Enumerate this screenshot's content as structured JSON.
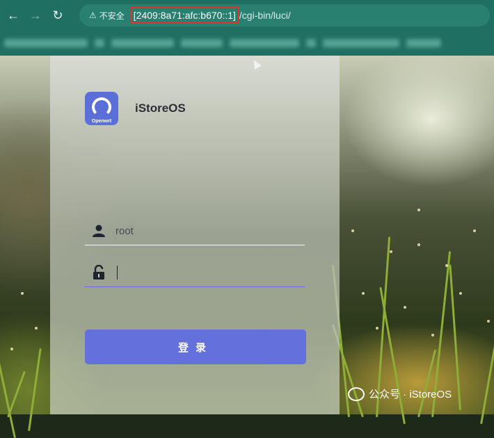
{
  "browser": {
    "security_label": "不安全",
    "url_host": "[2409:8a71:afc:b670::1]",
    "url_path": "/cgi-bin/luci/",
    "back_icon": "arrow-left-icon",
    "forward_icon": "arrow-right-icon",
    "reload_icon": "reload-icon",
    "warning_icon": "warning-triangle-icon"
  },
  "login": {
    "logo_text": "Openwrt",
    "brand": "iStoreOS",
    "username_value": "root",
    "password_value": "",
    "login_button": "登录",
    "accent_color": "#6470dc"
  },
  "watermark": {
    "text": "公众号 · iStoreOS"
  }
}
